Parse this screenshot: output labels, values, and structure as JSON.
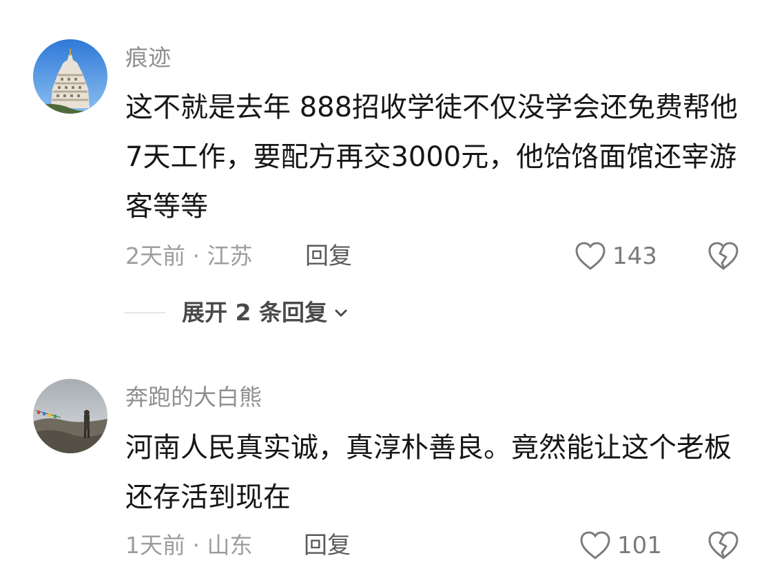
{
  "comments": [
    {
      "username": "痕迹",
      "content": "这不就是去年 888招收学徒不仅没学会还免费帮他7天工作，要配方再交3000元，他饸饹面馆还宰游客等等",
      "meta": "2天前 · 江苏",
      "reply_label": "回复",
      "like_count": "143",
      "avatar_icon": "temple-avatar",
      "expand_label": "展开 2 条回复"
    },
    {
      "username": "奔跑的大白熊",
      "content": "河南人民真实诚，真淳朴善良。竟然能让这个老板还存活到现在",
      "meta": "1天前 · 山东",
      "reply_label": "回复",
      "like_count": "101",
      "avatar_icon": "landscape-avatar"
    }
  ],
  "icons": {
    "like": "heart-outline-icon",
    "dislike": "broken-heart-icon",
    "expand": "chevron-down-icon"
  },
  "colors": {
    "text": "#161616",
    "muted": "#9d9d9d",
    "username": "#8f8f8f",
    "icon": "#7b7b7b"
  }
}
